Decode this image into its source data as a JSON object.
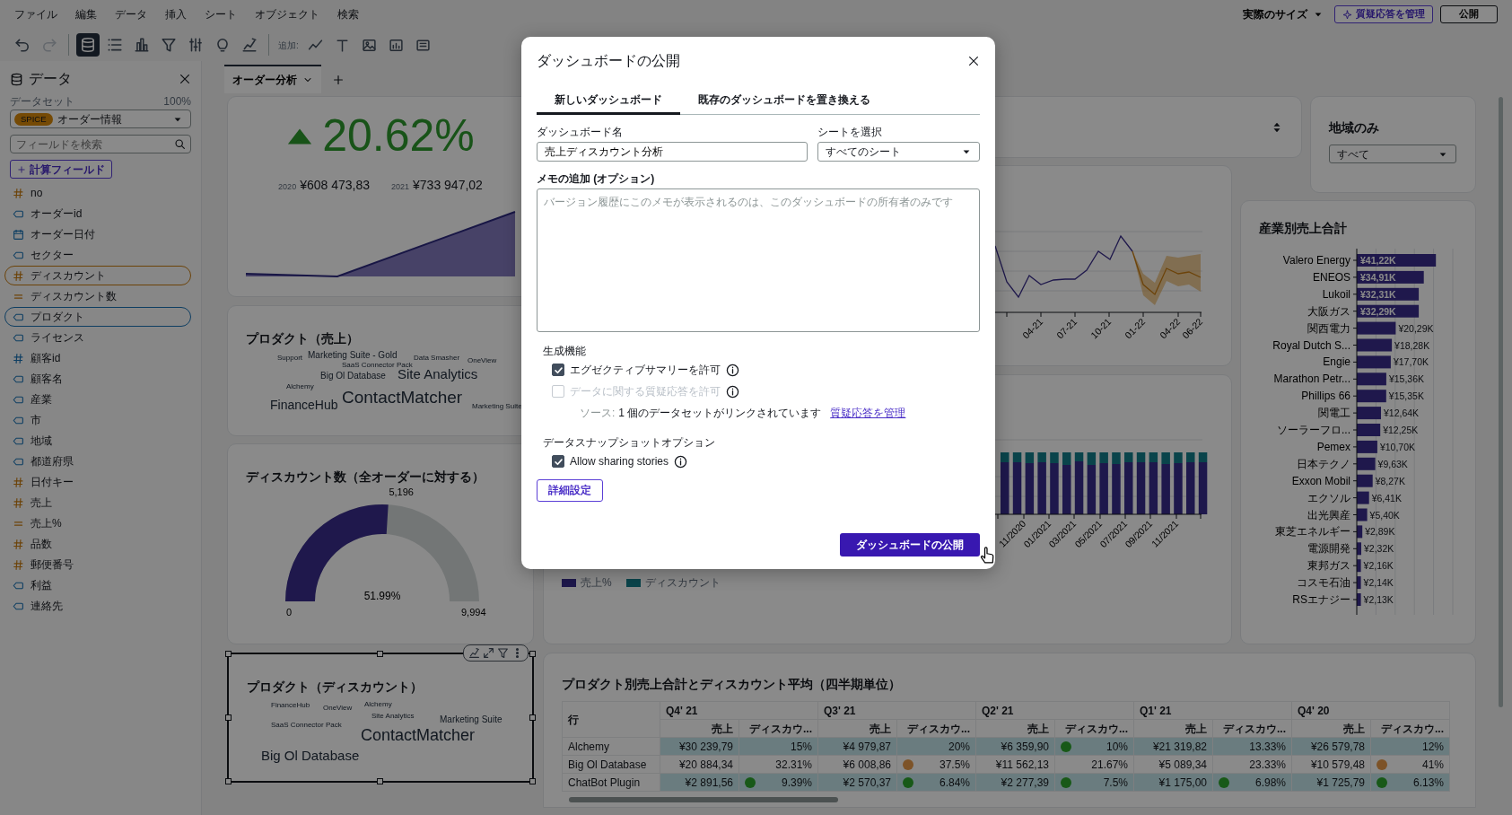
{
  "menu_bar": {
    "items": [
      "ファイル",
      "編集",
      "データ",
      "挿入",
      "シート",
      "オブジェクト",
      "検索"
    ],
    "zoom": "実際のサイズ",
    "qa_button": "質疑応答を管理",
    "publish_button": "公開"
  },
  "toolbar": {
    "tools": [
      {
        "kind": "undo",
        "selected": false,
        "disabled": false
      },
      {
        "kind": "redo",
        "selected": false,
        "disabled": true
      },
      {
        "kind": "database",
        "selected": true,
        "disabled": false
      },
      {
        "kind": "list",
        "selected": false,
        "disabled": false
      },
      {
        "kind": "bars",
        "selected": false,
        "disabled": false
      },
      {
        "kind": "filter",
        "selected": false,
        "disabled": false
      },
      {
        "kind": "sliders",
        "selected": false,
        "disabled": false
      },
      {
        "kind": "bulb",
        "selected": false,
        "disabled": false
      },
      {
        "kind": "trend",
        "selected": false,
        "disabled": false
      }
    ],
    "add_label": "追加:",
    "add_tools": [
      {
        "kind": "line"
      },
      {
        "kind": "text"
      },
      {
        "kind": "image"
      },
      {
        "kind": "imgchart"
      },
      {
        "kind": "embed"
      }
    ]
  },
  "data_panel": {
    "title": "データ",
    "dataset_label": "データセット",
    "usage": "100%",
    "dataset": {
      "badge": "SPICE",
      "name": "オーダー情報"
    },
    "search": {
      "placeholder": "フィールドを検索"
    },
    "add_field_button": "計算フィールド",
    "fields": [
      {
        "name": "no",
        "kind": "measure",
        "in_use": false
      },
      {
        "name": "オーダーid",
        "kind": "dimension",
        "in_use": false
      },
      {
        "name": "オーダー日付",
        "kind": "date",
        "in_use": false
      },
      {
        "name": "セクター",
        "kind": "dimension",
        "in_use": false
      },
      {
        "name": "ディスカウント",
        "kind": "measure",
        "in_use": true
      },
      {
        "name": "ディスカウント数",
        "kind": "calculated",
        "in_use": false
      },
      {
        "name": "プロダクト",
        "kind": "dimension",
        "in_use": true
      },
      {
        "name": "ライセンス",
        "kind": "dimension",
        "in_use": false
      },
      {
        "name": "顧客id",
        "kind": "numeric",
        "in_use": false
      },
      {
        "name": "顧客名",
        "kind": "dimension",
        "in_use": false
      },
      {
        "name": "産業",
        "kind": "dimension",
        "in_use": false
      },
      {
        "name": "市",
        "kind": "dimension",
        "in_use": false
      },
      {
        "name": "地域",
        "kind": "dimension",
        "in_use": false
      },
      {
        "name": "都道府県",
        "kind": "dimension",
        "in_use": false
      },
      {
        "name": "日付キー",
        "kind": "measure",
        "in_use": false
      },
      {
        "name": "売上",
        "kind": "measure",
        "in_use": false
      },
      {
        "name": "売上%",
        "kind": "calculated",
        "in_use": false
      },
      {
        "name": "品数",
        "kind": "measure",
        "in_use": false
      },
      {
        "name": "郵便番号",
        "kind": "measure",
        "in_use": false
      },
      {
        "name": "利益",
        "kind": "dimension",
        "in_use": false
      },
      {
        "name": "連絡先",
        "kind": "dimension",
        "in_use": false
      }
    ]
  },
  "sheet_tabs": [
    {
      "label": "オーダー分析",
      "selected": true
    }
  ],
  "visuals": {
    "kpi": {
      "value": "20.62%",
      "comparisons": [
        {
          "year": "2020",
          "amount": "¥608 473,83"
        },
        {
          "year": "2021",
          "amount": "¥733 947,02"
        }
      ]
    },
    "word_cloud_sales": {
      "title": "プロダクト（売上）",
      "words": [
        "Support",
        "Marketing Suite - Gold",
        "SaaS Connector Pack",
        "Data Smasher",
        "OneView",
        "Big Ol Database",
        "Site Analytics",
        "Alchemy",
        "FinanceHub",
        "ContactMatcher",
        "Marketing Suite"
      ]
    },
    "gauge": {
      "title": "ディスカウント数（全オーダーに対する）",
      "level": 0.5199,
      "value": "5,196",
      "min": "0",
      "max": "9,994",
      "percent": "51.99%"
    },
    "word_cloud_discount": {
      "title": "プロダクト（ディスカウント）",
      "selected": true,
      "words": [
        "FinanceHub",
        "OneView",
        "Alchemy",
        "Site Analytics",
        "Marketing Suite",
        "SaaS Connector Pack",
        "ContactMatcher",
        "Big Ol Database"
      ]
    },
    "forecast_chart": {
      "x_labels": [
        "04-21",
        "07-21",
        "10-21",
        "01-22",
        "04-22",
        "06-22"
      ]
    },
    "stacked_chart": {
      "x_labels": [
        "11/2020",
        "01/2021",
        "03/2021",
        "05/2021",
        "07/2021",
        "09/2021",
        "11/2021"
      ],
      "legend": [
        {
          "label": "売上%",
          "color": "#1f194c"
        },
        {
          "label": "ディスカウント",
          "color": "#0a444b"
        }
      ]
    },
    "region_filter": {
      "title": "地域のみ",
      "value": "すべて"
    },
    "industry_chart": {
      "chart_data": {
        "type": "bar",
        "orientation": "horizontal",
        "title": "産業別売上合計",
        "categories": [
          "Valero Energy",
          "ENEOS",
          "Lukoil",
          "大阪ガス",
          "関西電力",
          "Royal Dutch S...",
          "Engie",
          "Marathon Petr...",
          "Phillips 66",
          "関電工",
          "ソーラーフロ...",
          "Pemex",
          "日本テクノ",
          "Exxon Mobil",
          "エクソル",
          "出光興産",
          "東芝エネルギー",
          "電源開発",
          "東邦ガス",
          "コスモ石油",
          "RSエナジー"
        ],
        "values": [
          41.22,
          34.91,
          32.31,
          32.29,
          20.29,
          18.28,
          17.7,
          15.36,
          15.35,
          12.64,
          12.25,
          10.7,
          9.63,
          8.27,
          6.41,
          5.4,
          2.89,
          2.32,
          2.16,
          2.14,
          2.13
        ],
        "value_labels": [
          "¥41,22K",
          "¥34,91K",
          "¥32,31K",
          "¥32,29K",
          "¥20,29K",
          "¥18,28K",
          "¥17,70K",
          "¥15,36K",
          "¥15,35K",
          "¥12,64K",
          "¥12,25K",
          "¥10,70K",
          "¥9,63K",
          "¥8,27K",
          "¥6,41K",
          "¥5,40K",
          "¥2,89K",
          "¥2,32K",
          "¥2,16K",
          "¥2,14K",
          "¥2,13K"
        ]
      }
    },
    "quarter_table": {
      "title": "プロダクト別売上合計とディスカウント平均（四半期単位）",
      "row_header": "行",
      "groups": [
        {
          "label": "Q4' 21",
          "columns": [
            "売上",
            "ディスカウ..."
          ]
        },
        {
          "label": "Q3' 21",
          "columns": [
            "売上",
            "ディスカウ..."
          ]
        },
        {
          "label": "Q2' 21",
          "columns": [
            "売上",
            "ディスカウ..."
          ]
        },
        {
          "label": "Q1' 21",
          "columns": [
            "売上",
            "ディスカウ..."
          ]
        },
        {
          "label": "Q4' 20",
          "columns": [
            "売上",
            "ディスカウ..."
          ]
        }
      ],
      "rows": [
        {
          "label": "Alchemy",
          "highlighted": true,
          "cells": [
            {
              "text": "¥30 239,79"
            },
            {
              "text": "15%"
            },
            {
              "text": "¥4 979,87"
            },
            {
              "text": "20%"
            },
            {
              "text": "¥6 359,90"
            },
            {
              "text": "10%",
              "color": "#195919"
            },
            {
              "text": "¥21 319,82"
            },
            {
              "text": "13.33%"
            },
            {
              "text": "¥26 579,78"
            },
            {
              "text": "12%"
            }
          ]
        },
        {
          "label": "Big Ol Database",
          "highlighted": false,
          "cells": [
            {
              "text": "¥20 884,34"
            },
            {
              "text": "32.31%"
            },
            {
              "text": "¥6 008,86"
            },
            {
              "text": "37.5%",
              "color": "#7d5328"
            },
            {
              "text": "¥11 562,13"
            },
            {
              "text": "21.67%"
            },
            {
              "text": "¥5 089,34"
            },
            {
              "text": "23.33%"
            },
            {
              "text": "¥10 579,48"
            },
            {
              "text": "41%",
              "color": "#7d5328"
            }
          ]
        },
        {
          "label": "ChatBot Plugin",
          "highlighted": true,
          "cells": [
            {
              "text": "¥2 891,56"
            },
            {
              "text": "9.39%",
              "color": "#195919"
            },
            {
              "text": "¥2 570,37"
            },
            {
              "text": "6.84%",
              "color": "#195919"
            },
            {
              "text": "¥2 277,39"
            },
            {
              "text": "7.5%",
              "color": "#195919"
            },
            {
              "text": "¥1 175,00"
            },
            {
              "text": "6.98%",
              "color": "#195919"
            },
            {
              "text": "¥1 725,79"
            },
            {
              "text": "6.13%",
              "color": "#195919"
            }
          ]
        }
      ]
    }
  },
  "publish_dialog": {
    "title": "ダッシュボードの公開",
    "tabs": [
      {
        "label": "新しいダッシュボード",
        "selected": true
      },
      {
        "label": "既存のダッシュボードを置き換える",
        "selected": false
      }
    ],
    "name_label": "ダッシュボード名",
    "name_value": "売上ディスカウント分析",
    "sheet_label": "シートを選択",
    "sheet_value": "すべてのシート",
    "memo_label": "メモの追加 (オプション)",
    "memo_placeholder": "バージョン履歴にこのメモが表示されるのは、このダッシュボードの所有者のみです",
    "gen_section": "生成機能",
    "gen_options": [
      {
        "label": "エグゼクティブサマリーを許可",
        "checked": true,
        "disabled": false
      },
      {
        "label": "データに関する質疑応答を許可",
        "checked": false,
        "disabled": true
      }
    ],
    "source_label": "ソース:",
    "source_text": "1 個のデータセットがリンクされています",
    "source_link": "質疑応答を管理",
    "snapshot_section": "データスナップショットオプション",
    "snapshot_options": [
      {
        "label": "Allow sharing stories",
        "checked": true,
        "disabled": false
      }
    ],
    "advanced_button": "詳細設定",
    "publish_button": "ダッシュボードの公開"
  }
}
